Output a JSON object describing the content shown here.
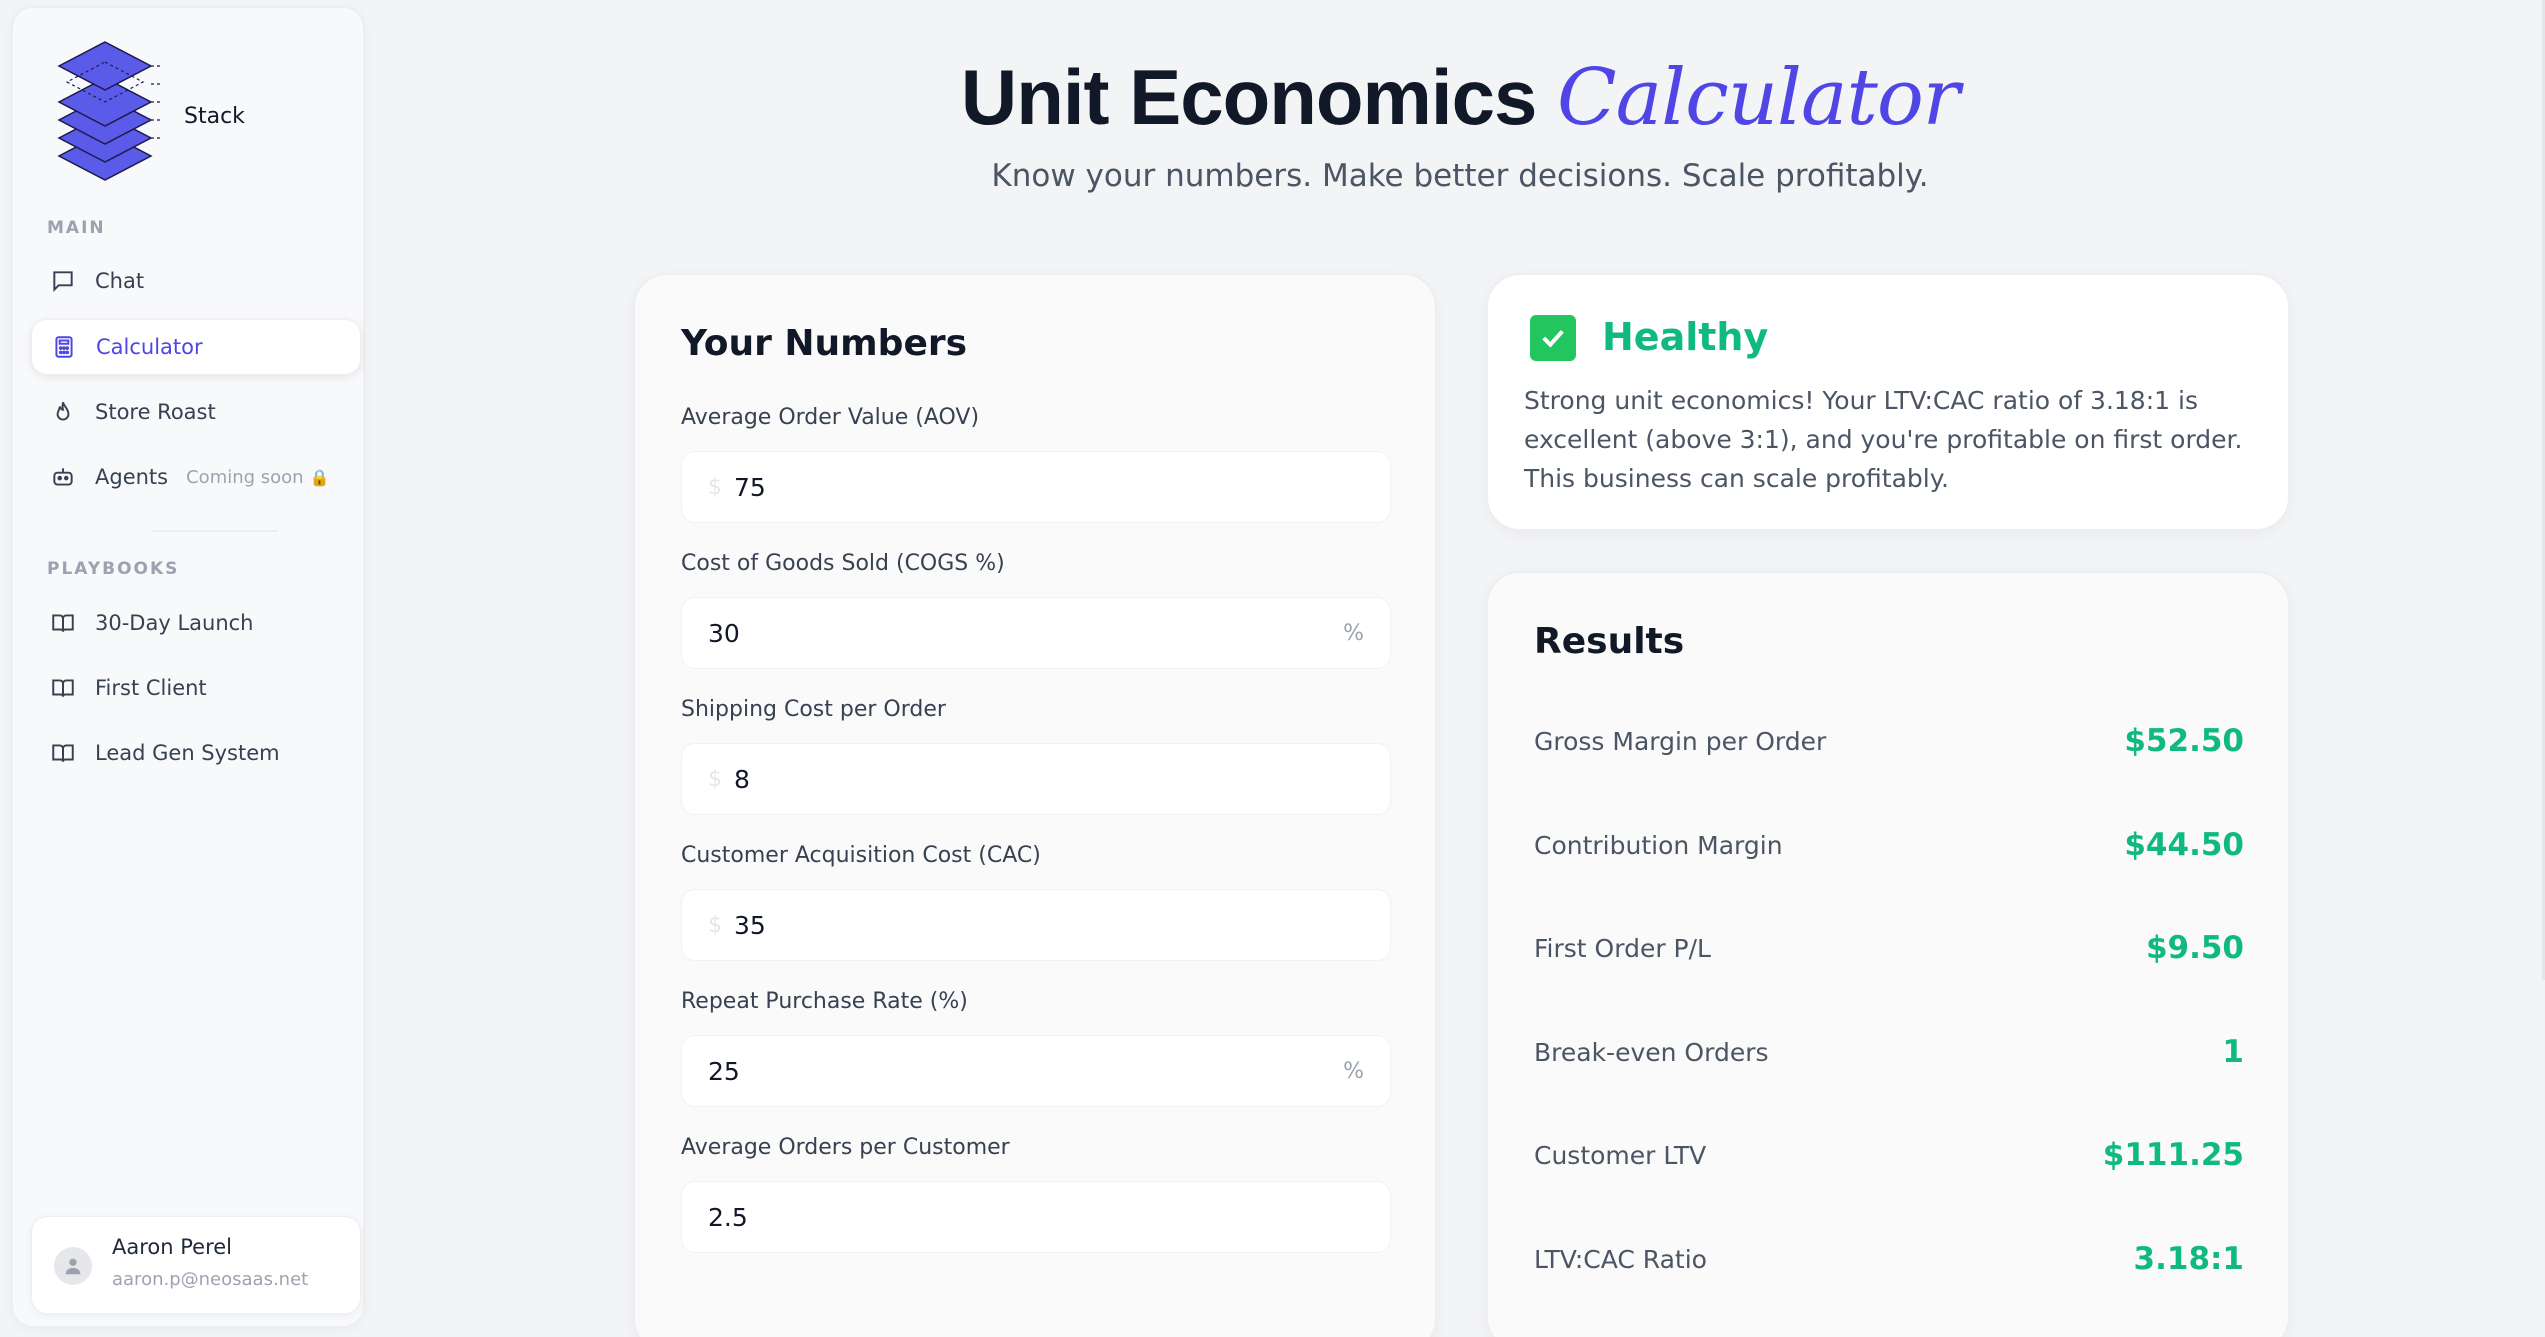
{
  "app": {
    "logo_text": "Stack"
  },
  "sidebar": {
    "main_label": "MAIN",
    "items": [
      {
        "label": "Chat",
        "icon": "chat-icon"
      },
      {
        "label": "Calculator",
        "icon": "calculator-icon",
        "active": true
      },
      {
        "label": "Store Roast",
        "icon": "flame-icon"
      },
      {
        "label": "Agents",
        "icon": "robot-icon",
        "badge": "Coming soon"
      }
    ],
    "playbooks_label": "PLAYBOOKS",
    "playbooks": [
      {
        "label": "30-Day Launch",
        "icon": "book-icon"
      },
      {
        "label": "First Client",
        "icon": "book-icon"
      },
      {
        "label": "Lead Gen System",
        "icon": "book-icon"
      }
    ],
    "user": {
      "name": "Aaron Perel",
      "email": "aaron.p@neosaas.net"
    }
  },
  "header": {
    "title_main": "Unit Economics",
    "title_accent": "Calculator",
    "subtitle": "Know your numbers. Make better decisions. Scale profitably."
  },
  "inputs": {
    "title": "Your Numbers",
    "fields": [
      {
        "label": "Average Order Value (AOV)",
        "value": "75",
        "prefix": "$"
      },
      {
        "label": "Cost of Goods Sold (COGS %)",
        "value": "30",
        "suffix": "%"
      },
      {
        "label": "Shipping Cost per Order",
        "value": "8",
        "prefix": "$"
      },
      {
        "label": "Customer Acquisition Cost (CAC)",
        "value": "35",
        "prefix": "$"
      },
      {
        "label": "Repeat Purchase Rate (%)",
        "value": "25",
        "suffix": "%"
      },
      {
        "label": "Average Orders per Customer",
        "value": "2.5"
      }
    ]
  },
  "status": {
    "title": "Healthy",
    "text": "Strong unit economics! Your LTV:CAC ratio of 3.18:1 is excellent (above 3:1), and you're profitable on first order. This business can scale profitably.",
    "color": "#10b981"
  },
  "results": {
    "title": "Results",
    "rows": [
      {
        "label": "Gross Margin per Order",
        "value": "$52.50"
      },
      {
        "label": "Contribution Margin",
        "value": "$44.50"
      },
      {
        "label": "First Order P/L",
        "value": "$9.50"
      },
      {
        "label": "Break-even Orders",
        "value": "1"
      },
      {
        "label": "Customer LTV",
        "value": "$111.25"
      },
      {
        "label": "LTV:CAC Ratio",
        "value": "3.18:1"
      }
    ]
  },
  "colors": {
    "accent": "#4f46e5",
    "positive": "#10b981"
  }
}
